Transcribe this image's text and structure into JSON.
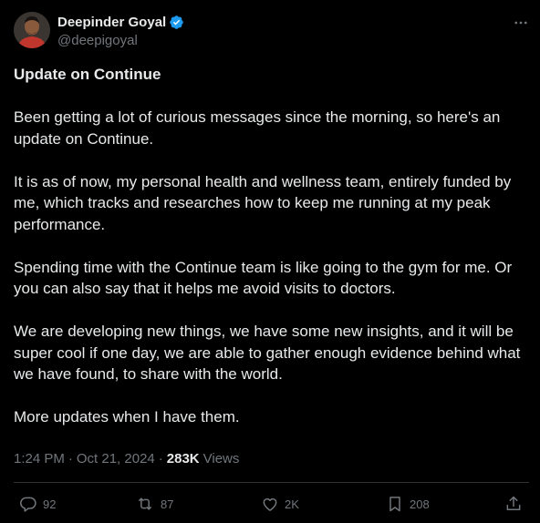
{
  "author": {
    "display_name": "Deepinder Goyal",
    "handle": "@deepigoyal",
    "verified": true,
    "verified_color": "#1d9bf0"
  },
  "tweet": {
    "title": "Update on Continue",
    "paragraphs": [
      "Been getting a lot of curious messages since the morning, so here's an update on Continue.",
      "It is as of now, my personal health and wellness team, entirely funded by me, which tracks and researches how to keep me running at my peak performance.",
      "Spending time with the Continue team is like going to the gym for me. Or you can also say that it helps me avoid visits to doctors.",
      "We are developing new things, we have some new insights, and it will be super cool if one day, we are able to gather enough evidence behind what we have found, to share with the world.",
      "More updates when I have them."
    ],
    "time": "1:24 PM",
    "date": "Oct 21, 2024",
    "views_count": "283K",
    "views_label": "Views"
  },
  "actions": {
    "replies": "92",
    "reposts": "87",
    "likes": "2K",
    "bookmarks": "208"
  },
  "icons": {
    "more": "more-horizontal-icon",
    "reply": "reply-icon",
    "repost": "repost-icon",
    "like": "heart-icon",
    "bookmark": "bookmark-icon",
    "share": "share-icon"
  },
  "colors": {
    "background": "#000000",
    "text_primary": "#e7e9ea",
    "text_secondary": "#71767b",
    "divider": "#2f3336"
  }
}
